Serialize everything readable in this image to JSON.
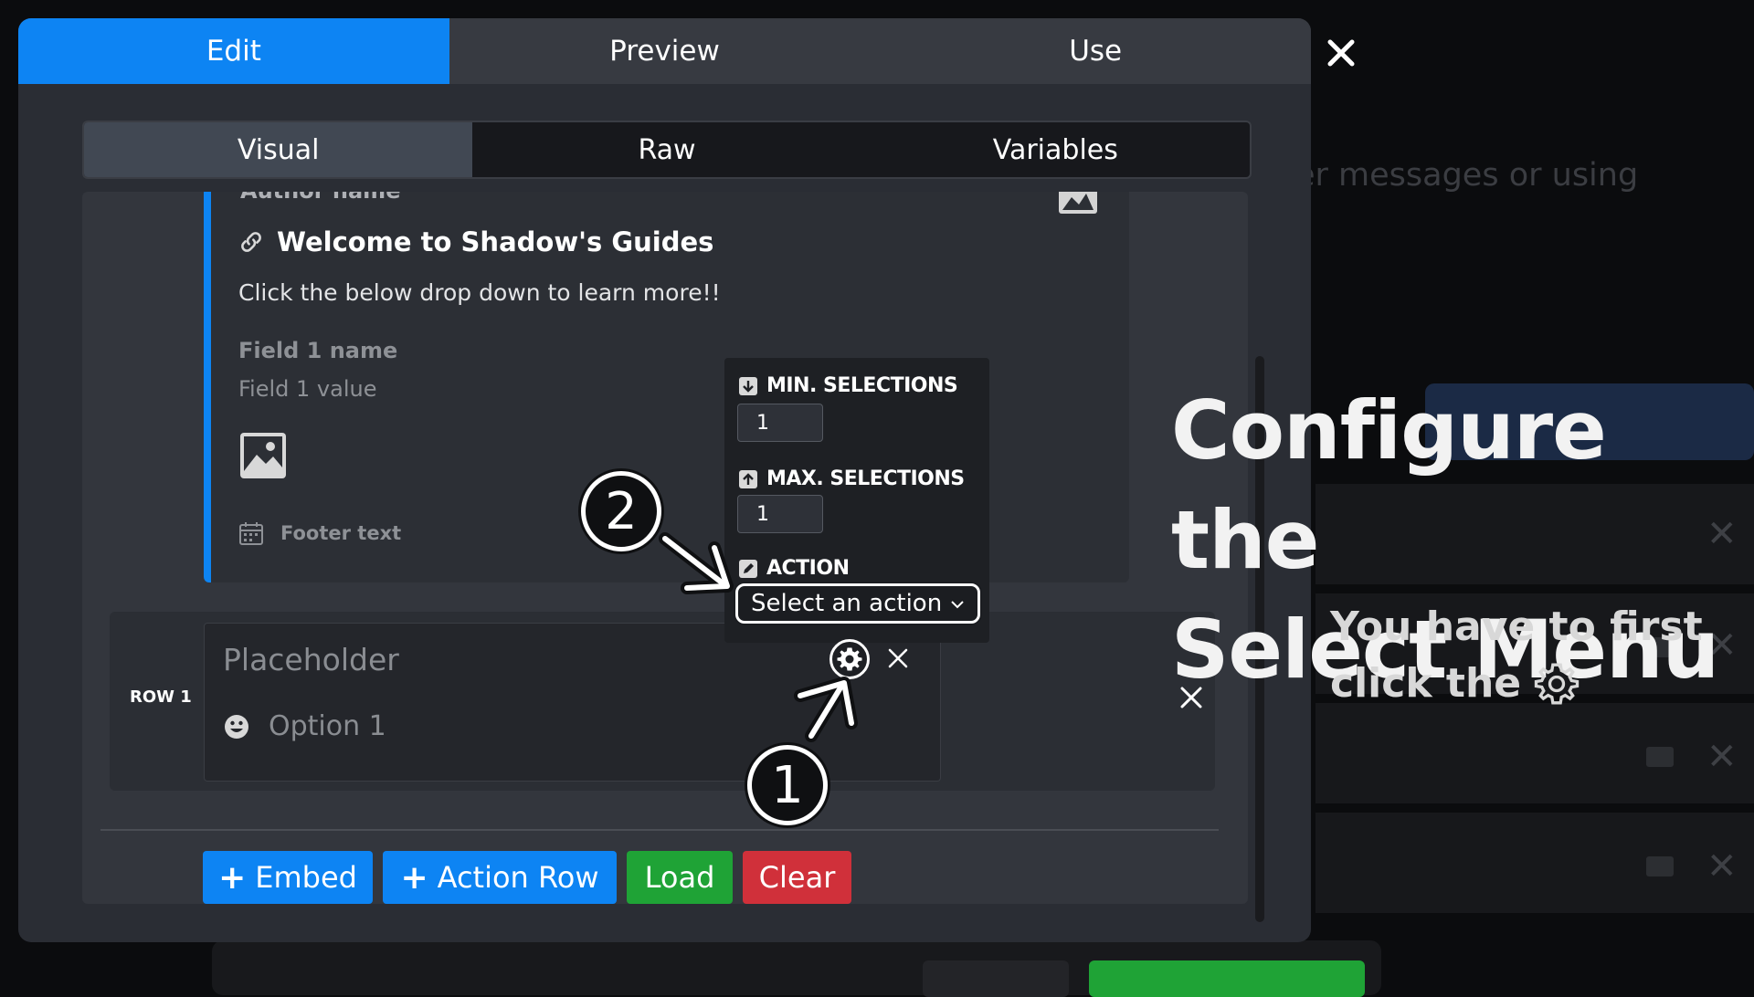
{
  "background": {
    "text": "er messages or using"
  },
  "top_tabs": [
    {
      "label": "Edit",
      "active": true
    },
    {
      "label": "Preview",
      "active": false
    },
    {
      "label": "Use",
      "active": false
    }
  ],
  "sub_tabs": [
    {
      "label": "Visual",
      "active": true
    },
    {
      "label": "Raw",
      "active": false
    },
    {
      "label": "Variables",
      "active": false
    }
  ],
  "embed": {
    "author": "Author name",
    "title": "Welcome to Shadow's Guides",
    "description": "Click the below drop down to learn more!!",
    "field_name": "Field 1 name",
    "field_value": "Field 1 value",
    "footer": "Footer text"
  },
  "action_row": {
    "label": "ROW 1",
    "placeholder": "Placeholder",
    "option": "Option 1"
  },
  "popup": {
    "min_label": "MIN. SELECTIONS",
    "min_value": "1",
    "max_label": "MAX. SELECTIONS",
    "max_value": "1",
    "action_label": "ACTION",
    "action_value": "Select an action"
  },
  "buttons": {
    "embed": "Embed",
    "action_row": "Action Row",
    "load": "Load",
    "clear": "Clear"
  },
  "steps": {
    "one": "1",
    "two": "2"
  },
  "caption": {
    "title_line1": "Configure the",
    "title_line2": "Select Menu",
    "sub_line1": "You have to first",
    "sub_line2": "click the"
  },
  "colors": {
    "accent": "#0d84f3",
    "green": "#1fa336",
    "red": "#d0303a"
  }
}
